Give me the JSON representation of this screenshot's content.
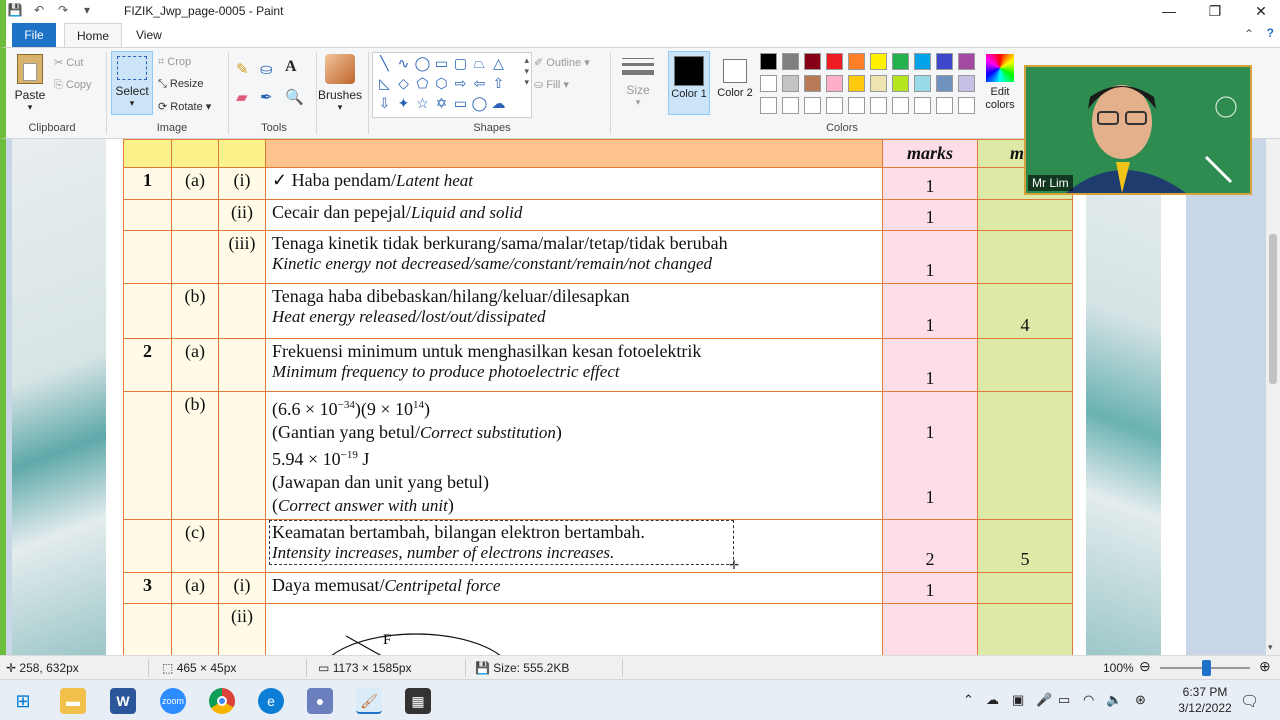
{
  "window": {
    "title": "FIZIK_Jwp_page-0005 - Paint"
  },
  "menu": {
    "file": "File",
    "home": "Home",
    "view": "View"
  },
  "ribbon": {
    "clipboard": {
      "paste": "Paste",
      "cut": "Cut",
      "copy": "Copy",
      "label": "Clipboard"
    },
    "image": {
      "select": "Select",
      "crop": "Crop",
      "resize": "Resize",
      "rotate": "Rotate",
      "label": "Image"
    },
    "tools": {
      "label": "Tools"
    },
    "brushes": "Brushes",
    "shapes": {
      "outline": "Outline",
      "fill": "Fill",
      "label": "Shapes"
    },
    "size": "Size",
    "color1": "Color 1",
    "color2": "Color 2",
    "edit_colors": "Edit colors",
    "colors_label": "Colors",
    "palette": [
      "#000000",
      "#7f7f7f",
      "#880015",
      "#ed1c24",
      "#ff7f27",
      "#fff200",
      "#22b14c",
      "#00a2e8",
      "#3f48cc",
      "#a349a4",
      "#ffffff",
      "#c3c3c3",
      "#b97a57",
      "#ffaec9",
      "#ffc90e",
      "#efe4b0",
      "#b5e61d",
      "#99d9ea",
      "#7092be",
      "#c8bfe7"
    ]
  },
  "sheet": {
    "header_marks": "marks",
    "header_marks2": "mar",
    "rows": [
      {
        "q": "1",
        "p": "(a)",
        "s": "(i)",
        "ms": "✓ Haba pendam/",
        "en": "Latent heat",
        "mk": "1",
        "tot": ""
      },
      {
        "q": "",
        "p": "",
        "s": "(ii)",
        "ms": "Cecair dan pepejal/",
        "en": "Liquid and solid",
        "mk": "1",
        "tot": ""
      },
      {
        "q": "",
        "p": "",
        "s": "(iii)",
        "ms": "Tenaga kinetik tidak berkurang/sama/malar/tetap/tidak berubah",
        "en": "Kinetic energy not decreased/same/constant/remain/not changed",
        "mk": "1",
        "tot": ""
      },
      {
        "q": "",
        "p": "(b)",
        "s": "",
        "ms": "Tenaga haba dibebaskan/hilang/keluar/dilesapkan",
        "en": "Heat energy released/lost/out/dissipated",
        "mk": "1",
        "tot": "4"
      },
      {
        "q": "2",
        "p": "(a)",
        "s": "",
        "ms": "Frekuensi minimum untuk menghasilkan kesan fotoelektrik",
        "en": "Minimum frequency to produce photoelectric effect",
        "mk": "1",
        "tot": ""
      }
    ],
    "row_2b": {
      "p": "(b)",
      "line1a": "(6.6 × 10",
      "line1b": "−34",
      "line1c": ")(9 × 10",
      "line1d": "14",
      "line1e": ")",
      "line2a": "(Gantian yang betul/",
      "line2b": "Correct substitution",
      "line2c": ")",
      "line3a": "5.94 × 10",
      "line3b": "−19",
      "line3c": " J",
      "line4": "(Jawapan dan unit yang betul)",
      "line5a": "(",
      "line5b": "Correct answer with unit",
      "line5c": ")",
      "mk1": "1",
      "mk2": "1"
    },
    "row_2c": {
      "p": "(c)",
      "ms": "Keamatan bertambah, bilangan elektron bertambah.",
      "en": "Intensity increases, number of electrons increases.",
      "mk": "2",
      "tot": "5"
    },
    "row_3a": {
      "q": "3",
      "p": "(a)",
      "s": "(i)",
      "ms": "Daya memusat/",
      "en": "Centripetal force",
      "mk": "1"
    },
    "row_3aii": {
      "s": "(ii)",
      "fig": "F"
    }
  },
  "video": {
    "name": "Mr Lim"
  },
  "status": {
    "cursor": "258, 632px",
    "selection": "465 × 45px",
    "image_size": "1173 × 1585px",
    "file_size": "Size: 555.2KB",
    "zoom": "100%"
  },
  "taskbar": {
    "time": "6:37 PM",
    "date": "3/12/2022"
  }
}
